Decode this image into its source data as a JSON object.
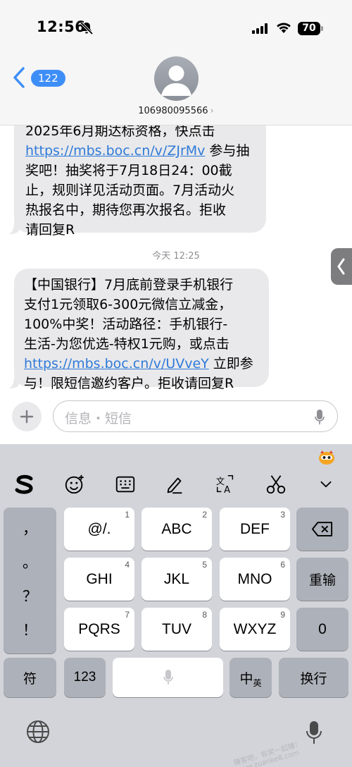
{
  "status_bar": {
    "time": "12:56",
    "battery": "70"
  },
  "header": {
    "back_count": "122",
    "contact": "106980095566",
    "chevron": "›"
  },
  "messages": [
    {
      "lines_before_link": [
        "2025年6月期达标资格，快点击"
      ],
      "link": "https://mbs.boc.cn/v/ZJrMv",
      "text_after_link": " 参与抽",
      "lines_after": [
        "奖吧！抽奖将于7月18日24：00截",
        "止，规则详见活动页面。7月活动火",
        "热报名中，期待您再次报名。拒收",
        "请回复R"
      ]
    },
    {
      "lines_before_link": [
        "【中国银行】7月底前登录手机银行",
        "支付1元领取6-300元微信立减金，",
        "100%中奖！活动路径：手机银行-",
        "生活-为您优选-特权1元购，或点击"
      ],
      "link": "https://mbs.boc.cn/v/UVveY",
      "text_after_link": " 立即参",
      "lines_after": [
        "与！限短信邀约客户。拒收请回复R"
      ]
    }
  ],
  "timestamp": "今天 12:25",
  "input": {
    "placeholder": "信息・短信"
  },
  "keyboard": {
    "punctuation": [
      "，",
      "。",
      "？",
      "！"
    ],
    "keys": [
      {
        "label": "@/.",
        "num": "1"
      },
      {
        "label": "ABC",
        "num": "2"
      },
      {
        "label": "DEF",
        "num": "3"
      },
      {
        "label": "GHI",
        "num": "4"
      },
      {
        "label": "JKL",
        "num": "5"
      },
      {
        "label": "MNO",
        "num": "6"
      },
      {
        "label": "PQRS",
        "num": "7"
      },
      {
        "label": "TUV",
        "num": "8"
      },
      {
        "label": "WXYZ",
        "num": "9"
      }
    ],
    "reenter": "重输",
    "zero": "0",
    "symbol": "符",
    "numbers": "123",
    "lang_main": "中",
    "lang_sub": "英",
    "enter": "换行"
  },
  "watermark": "赚客吧，有奖一起赚！www.zuanke8.com"
}
